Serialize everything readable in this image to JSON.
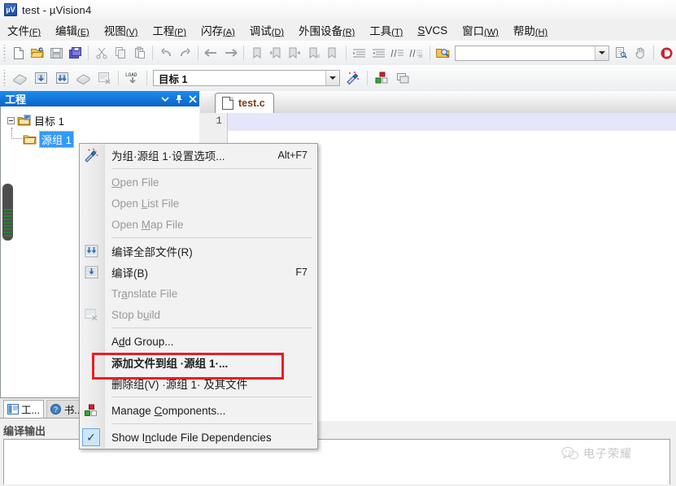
{
  "window": {
    "title": "test  - µVision4",
    "app_icon": "uvision-logo-icon",
    "icon_text": "µV"
  },
  "menubar": {
    "items": [
      {
        "label": "文件",
        "mnemonic": "(F)",
        "name": "menu-file"
      },
      {
        "label": "编辑",
        "mnemonic": "(E)",
        "name": "menu-edit"
      },
      {
        "label": "视图",
        "mnemonic": "(V)",
        "name": "menu-view"
      },
      {
        "label": "工程",
        "mnemonic": "(P)",
        "name": "menu-project"
      },
      {
        "label": "闪存",
        "mnemonic": "(A)",
        "name": "menu-flash"
      },
      {
        "label": "调试",
        "mnemonic": "(D)",
        "name": "menu-debug"
      },
      {
        "label": "外围设备",
        "mnemonic": "(R)",
        "name": "menu-peripherals"
      },
      {
        "label": "工具",
        "mnemonic": "(T)",
        "name": "menu-tools"
      },
      {
        "label": "SVCS",
        "mnemonic": "",
        "name": "menu-svcs"
      },
      {
        "label": "窗口",
        "mnemonic": "(W)",
        "name": "menu-window"
      },
      {
        "label": "帮助",
        "mnemonic": "(H)",
        "name": "menu-help"
      }
    ]
  },
  "toolbar2": {
    "target_value": "目标 1",
    "target_placeholder": "",
    "search_value": "",
    "search_placeholder": ""
  },
  "project": {
    "panel_title": "工程",
    "header_buttons": [
      "dropdown-icon",
      "pin-icon",
      "close-icon"
    ],
    "tree": {
      "root": "目标 1",
      "child": "源组 1"
    },
    "tabs": [
      {
        "label": "工...",
        "name": "project-tab-project",
        "active": true
      },
      {
        "label": "书...",
        "name": "project-tab-books",
        "active": false
      }
    ]
  },
  "build": {
    "title": "编译输出",
    "content": ""
  },
  "editor": {
    "tabs": [
      {
        "label": "test.c",
        "name": "editor-tab-testc",
        "active": true
      }
    ],
    "line_numbers": [
      "1"
    ],
    "lines": [
      ""
    ]
  },
  "context_menu": {
    "items": [
      {
        "kind": "item",
        "label": "为组·源组 1·设置选项...",
        "accel": "Alt+F7",
        "icon": "options-wand-icon",
        "disabled": false,
        "bold": false,
        "name": "ctx-options-for-group"
      },
      {
        "kind": "separator"
      },
      {
        "kind": "item",
        "label": "Open File",
        "mn": "O",
        "accel": "",
        "icon": "",
        "disabled": true,
        "bold": false,
        "name": "ctx-open-file"
      },
      {
        "kind": "item",
        "label": "Open List File",
        "mn": "L",
        "accel": "",
        "icon": "",
        "disabled": true,
        "bold": false,
        "name": "ctx-open-list-file"
      },
      {
        "kind": "item",
        "label": "Open Map File",
        "mn": "M",
        "accel": "",
        "icon": "",
        "disabled": true,
        "bold": false,
        "name": "ctx-open-map-file"
      },
      {
        "kind": "separator"
      },
      {
        "kind": "item",
        "label": "编译全部文件(R)",
        "accel": "",
        "icon": "rebuild-icon",
        "disabled": false,
        "bold": false,
        "name": "ctx-rebuild-all"
      },
      {
        "kind": "item",
        "label": "编译(B)",
        "accel": "F7",
        "icon": "build-icon",
        "disabled": false,
        "bold": false,
        "name": "ctx-build"
      },
      {
        "kind": "item",
        "label": "Translate File",
        "mn": "a",
        "accel": "",
        "icon": "",
        "disabled": true,
        "bold": false,
        "name": "ctx-translate-file"
      },
      {
        "kind": "item",
        "label": "Stop build",
        "mn": "u",
        "accel": "",
        "icon": "stop-build-icon",
        "disabled": true,
        "bold": false,
        "name": "ctx-stop-build"
      },
      {
        "kind": "separator"
      },
      {
        "kind": "item",
        "label": "Add Group...",
        "mn": "d",
        "accel": "",
        "icon": "",
        "disabled": false,
        "bold": false,
        "name": "ctx-add-group"
      },
      {
        "kind": "item",
        "label": "添加文件到组 ·源组 1·...",
        "accel": "",
        "icon": "",
        "disabled": false,
        "bold": true,
        "name": "ctx-add-files-to-group"
      },
      {
        "kind": "item",
        "label": "删除组(V) ·源组 1· 及其文件",
        "accel": "",
        "icon": "",
        "disabled": false,
        "bold": false,
        "name": "ctx-remove-group"
      },
      {
        "kind": "separator"
      },
      {
        "kind": "item",
        "label": "Manage Components...",
        "mn": "C",
        "accel": "",
        "icon": "manage-components-icon",
        "disabled": false,
        "bold": false,
        "name": "ctx-manage-components"
      },
      {
        "kind": "separator"
      },
      {
        "kind": "item",
        "label": "Show Include File Dependencies",
        "mn": "n",
        "accel": "",
        "icon": "check-icon",
        "checked": true,
        "disabled": false,
        "bold": false,
        "name": "ctx-show-include-file-dependencies"
      }
    ]
  },
  "annotation": {
    "highlight_color": "#ec1c24",
    "target": "添加文件到组 ·源组 1·..."
  },
  "watermark": {
    "text": "电子荣耀",
    "icon": "wechat-icon"
  },
  "colors": {
    "panel_header": "#0b63c6",
    "tab_text": "#7a3a12",
    "selection": "#3399ff",
    "current_line": "#e6e6fa",
    "annotation_red": "#ec1c24"
  }
}
